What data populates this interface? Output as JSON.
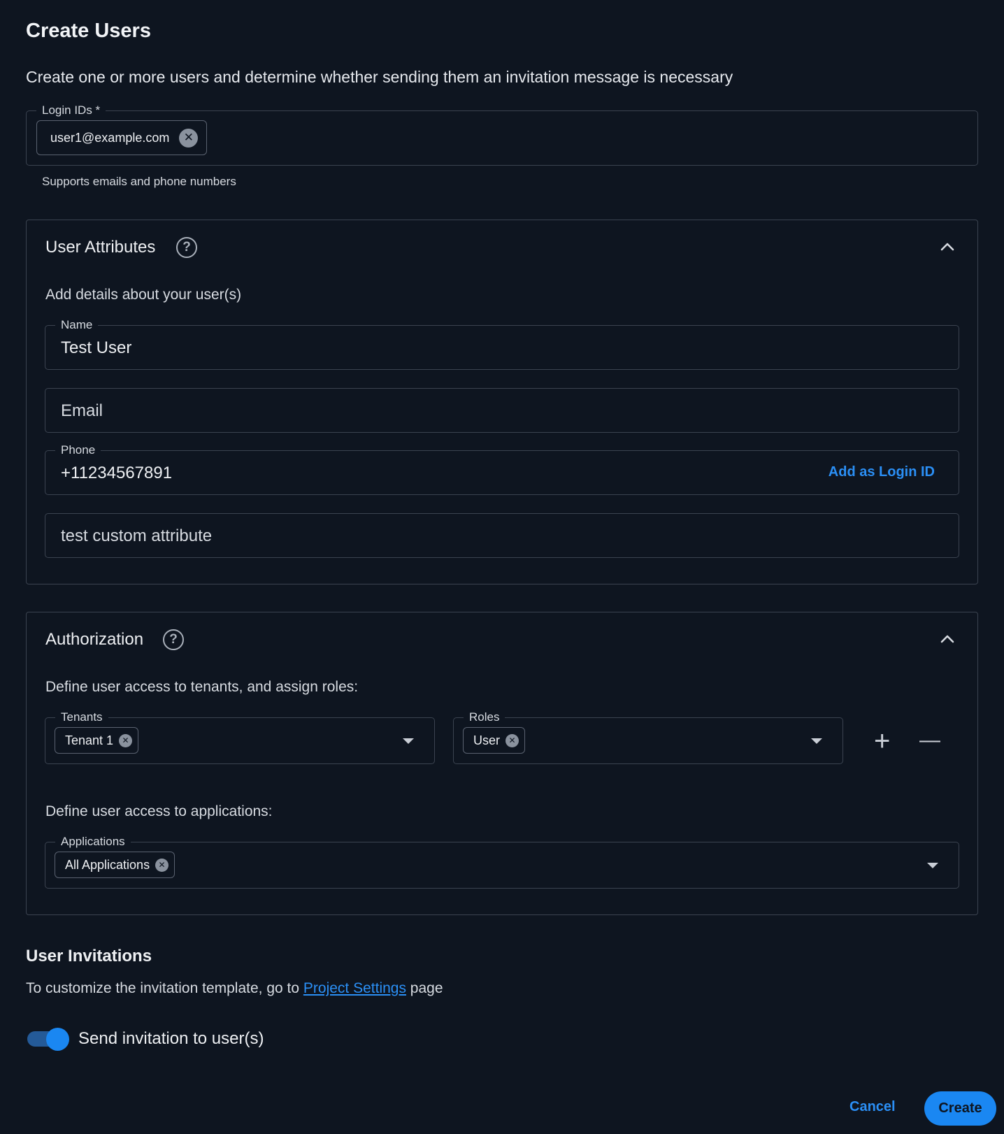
{
  "header": {
    "title": "Create Users",
    "subtitle": "Create one or more users and determine whether sending them an invitation message is necessary"
  },
  "login_ids": {
    "label": "Login IDs *",
    "chips": [
      "user1@example.com"
    ],
    "helper": "Supports emails and phone numbers"
  },
  "user_attributes": {
    "title": "User Attributes",
    "description": "Add details about your user(s)",
    "name": {
      "label": "Name",
      "value": "Test User"
    },
    "email": {
      "placeholder": "Email"
    },
    "phone": {
      "label": "Phone",
      "value": "+11234567891",
      "action": "Add as Login ID"
    },
    "custom": {
      "placeholder": "test custom attribute"
    }
  },
  "authorization": {
    "title": "Authorization",
    "tenants_description": "Define user access to tenants, and assign roles:",
    "tenants": {
      "label": "Tenants",
      "chips": [
        "Tenant 1"
      ]
    },
    "roles": {
      "label": "Roles",
      "chips": [
        "User"
      ]
    },
    "add_symbol": "+",
    "remove_symbol": "—",
    "applications_description": "Define user access to applications:",
    "applications": {
      "label": "Applications",
      "chips": [
        "All Applications"
      ]
    }
  },
  "invitations": {
    "title": "User Invitations",
    "text_before": "To customize the invitation template, go to ",
    "link": "Project Settings",
    "text_after": " page",
    "toggle_label": "Send invitation to user(s)",
    "toggle_on": true
  },
  "footer": {
    "cancel_label": "Cancel",
    "create_label": "Create"
  },
  "colors": {
    "background": "#0e1520",
    "accent": "#1a87f2",
    "border": "#3b4350"
  }
}
